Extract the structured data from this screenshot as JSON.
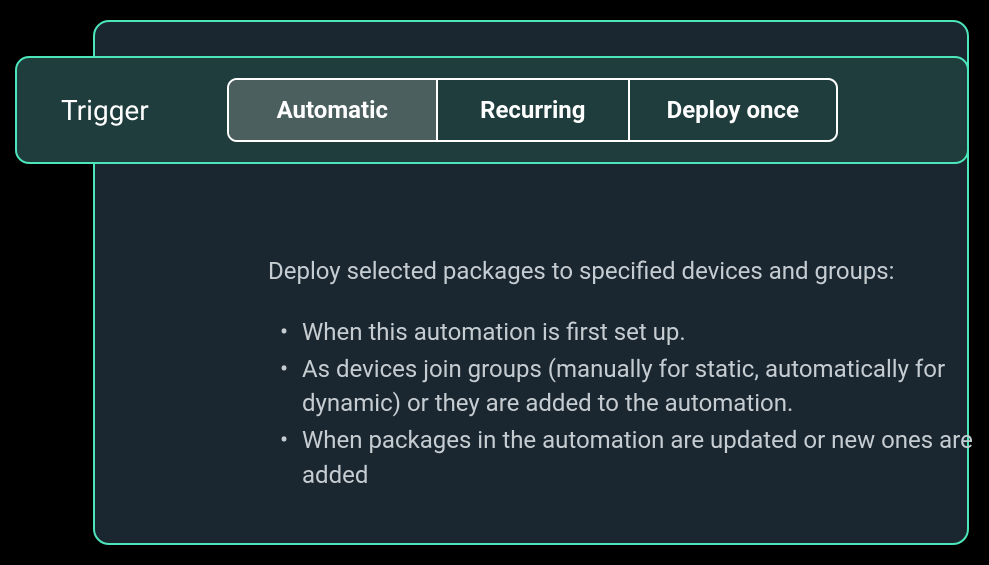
{
  "trigger": {
    "label": "Trigger",
    "options": [
      {
        "label": "Automatic",
        "active": true
      },
      {
        "label": "Recurring",
        "active": false
      },
      {
        "label": "Deploy once",
        "active": false
      }
    ]
  },
  "description": {
    "intro": "Deploy selected packages to specified devices and groups:",
    "bullets": [
      "When this automation is first set up.",
      "As devices join groups (manually for static, automatically for dynamic) or they are added to the automation.",
      "When packages in the automation are updated or new ones are added"
    ]
  }
}
